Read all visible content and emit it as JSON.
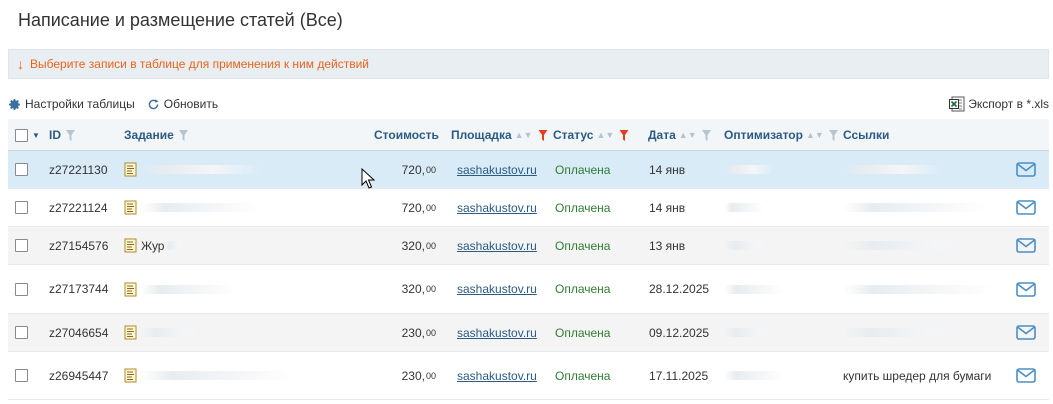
{
  "page": {
    "title": "Написание и размещение статей (Все)",
    "notice": "Выберите записи в таблице для применения к ним действий"
  },
  "toolbar": {
    "settings_label": "Настройки таблицы",
    "refresh_label": "Обновить",
    "export_label": "Экспорт в *.xls"
  },
  "columns": {
    "id": "ID",
    "task": "Задание",
    "cost": "Стоимость",
    "site": "Площадка",
    "status": "Статус",
    "date": "Дата",
    "optimizer": "Оптимизатор",
    "links": "Ссылки"
  },
  "rows": [
    {
      "id": "z27221130",
      "task": "",
      "cost_int": "720,",
      "cost_dec": "00",
      "site": "sashakustov.ru",
      "status": "Оплачена",
      "date": "14 янв",
      "optimizer": "",
      "links": ""
    },
    {
      "id": "z27221124",
      "task": "",
      "cost_int": "720,",
      "cost_dec": "00",
      "site": "sashakustov.ru",
      "status": "Оплачена",
      "date": "14 янв",
      "optimizer": "",
      "links": ""
    },
    {
      "id": "z27154576",
      "task": "Жур",
      "cost_int": "320,",
      "cost_dec": "00",
      "site": "sashakustov.ru",
      "status": "Оплачена",
      "date": "13 янв",
      "optimizer": "",
      "links": ""
    },
    {
      "id": "z27173744",
      "task": "",
      "cost_int": "320,",
      "cost_dec": "00",
      "site": "sashakustov.ru",
      "status": "Оплачена",
      "date": "28.12.2025",
      "optimizer": "",
      "links": ""
    },
    {
      "id": "z27046654",
      "task": "",
      "cost_int": "230,",
      "cost_dec": "00",
      "site": "sashakustov.ru",
      "status": "Оплачена",
      "date": "09.12.2025",
      "optimizer": "",
      "links": ""
    },
    {
      "id": "z26945447",
      "task": "",
      "cost_int": "230,",
      "cost_dec": "00",
      "site": "sashakustov.ru",
      "status": "Оплачена",
      "date": "17.11.2025",
      "optimizer": "",
      "links": "купить шредер для бумаги"
    }
  ],
  "colors": {
    "accent": "#2a5b86",
    "notice": "#e8641b",
    "status_paid": "#2e7d32",
    "highlight_row": "#d8ebf7",
    "mail_icon": "#4a8fc4"
  },
  "icons": {
    "settings": "gear-icon",
    "refresh": "refresh-icon",
    "export": "excel-icon",
    "filter": "funnel-icon",
    "task": "document-icon",
    "message": "envelope-icon"
  }
}
